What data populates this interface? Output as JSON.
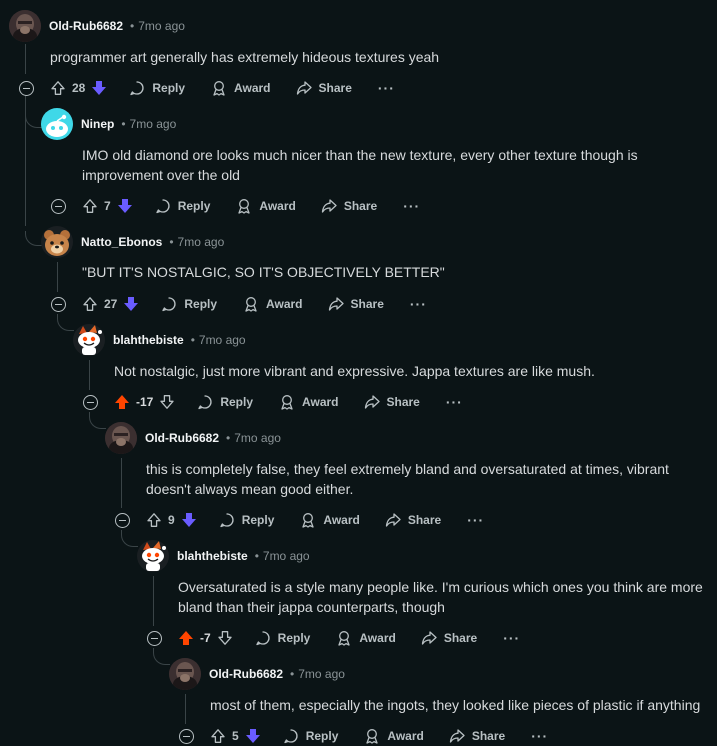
{
  "comments": [
    {
      "author": "Old-Rub6682",
      "time": "7mo ago",
      "text": "programmer art generally has extremely hideous textures yeah",
      "score": "28",
      "vote": "down",
      "avatar": "dark"
    },
    {
      "author": "Ninep",
      "time": "7mo ago",
      "text": "IMO old diamond ore looks much nicer than the new texture, every other texture though is improvement over the old",
      "score": "7",
      "vote": "down",
      "avatar": "cyan"
    },
    {
      "author": "Natto_Ebonos",
      "time": "7mo ago",
      "text": "\"BUT IT'S NOSTALGIC, SO IT'S OBJECTIVELY BETTER\"",
      "score": "27",
      "vote": "down",
      "avatar": "bear"
    },
    {
      "author": "blahthebiste",
      "time": "7mo ago",
      "text": "Not nostalgic, just more vibrant and expressive. Jappa textures are like mush.",
      "score": "-17",
      "vote": "up",
      "avatar": "snoo"
    },
    {
      "author": "Old-Rub6682",
      "time": "7mo ago",
      "text": "this is completely false, they feel extremely bland and oversaturated at times, vibrant doesn't always mean good either.",
      "score": "9",
      "vote": "down",
      "avatar": "dark"
    },
    {
      "author": "blahthebiste",
      "time": "7mo ago",
      "text": "Oversaturated is a style many people like. I'm curious which ones you think are more bland than their jappa counterparts, though",
      "score": "-7",
      "vote": "up",
      "avatar": "snoo"
    },
    {
      "author": "Old-Rub6682",
      "time": "7mo ago",
      "text": "most of them, especially the ingots, they looked like pieces of plastic if anything",
      "score": "5",
      "vote": "down",
      "avatar": "dark"
    }
  ],
  "labels": {
    "reply": "Reply",
    "award": "Award",
    "share": "Share",
    "more": "···",
    "dot": "•"
  },
  "colors": {
    "upvote": "#ff4500",
    "downvote": "#6a5cff",
    "background": "#0b1416"
  }
}
